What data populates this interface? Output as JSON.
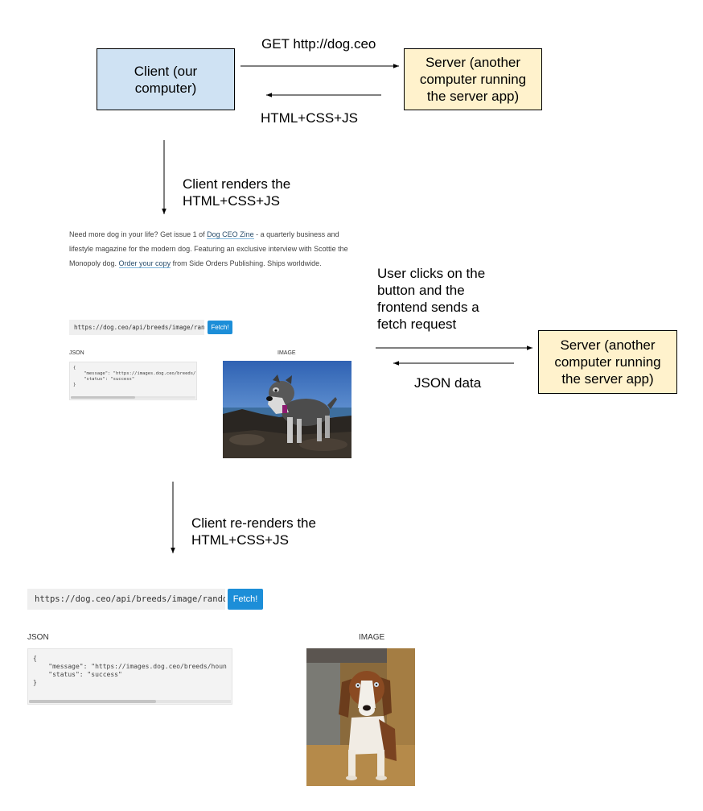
{
  "top": {
    "client_label": "Client (our\ncomputer)",
    "server_label": "Server (another\ncomputer running\nthe server app)",
    "request_label": "GET http://dog.ceo",
    "response_label": "HTML+CSS+JS",
    "render_label": "Client renders the\nHTML+CSS+JS"
  },
  "page": {
    "zine_before": "Need more dog in your life? Get issue 1 of ",
    "zine_link1": "Dog CEO Zine",
    "zine_middle": " - a quarterly business and lifestyle magazine for the modern dog. Featuring an exclusive interview with Scottie the Monopoly dog. ",
    "zine_link2": "Order your copy",
    "zine_after": " from Side Orders Publishing. Ships worldwide.",
    "url_value": "https://dog.ceo/api/breeds/image/random",
    "fetch_label": "Fetch!",
    "json_caption": "JSON",
    "image_caption": "IMAGE",
    "json_text": "{\n    \"message\": \"https://images.dog.ceo/breeds/\n    \"status\": \"success\"\n}"
  },
  "middle": {
    "click_label": "User clicks on the\nbutton and the\nfrontend sends a\nfetch request",
    "server_label": "Server (another\ncomputer running\nthe server app)",
    "json_data_label": "JSON data",
    "rerender_label": "Client re-renders the\nHTML+CSS+JS"
  },
  "bottom": {
    "url_value": "https://dog.ceo/api/breeds/image/random",
    "fetch_label": "Fetch!",
    "json_caption": "JSON",
    "image_caption": "IMAGE",
    "json_text": "{\n    \"message\": \"https://images.dog.ceo/breeds/houn\n    \"status\": \"success\"\n}"
  },
  "images": {
    "first_photo": "schnauzer-photo",
    "second_photo": "hound-photo"
  }
}
